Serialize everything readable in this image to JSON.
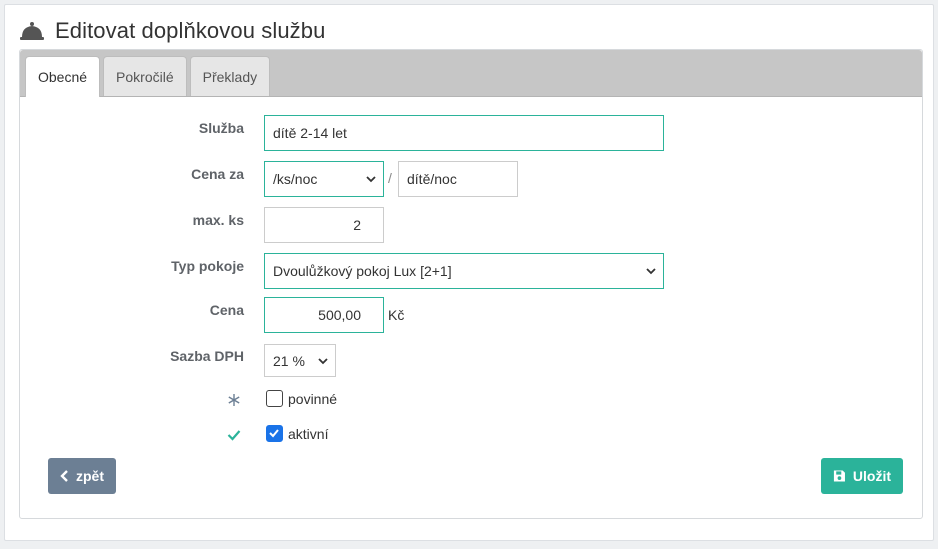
{
  "header": {
    "title": "Editovat doplňkovou službu",
    "icon": "bell-icon"
  },
  "tabs": [
    {
      "label": "Obecné",
      "active": true
    },
    {
      "label": "Pokročilé",
      "active": false
    },
    {
      "label": "Překlady",
      "active": false
    }
  ],
  "form": {
    "sluzba": {
      "label": "Služba",
      "value": "dítě 2-14 let"
    },
    "cena_za": {
      "label": "Cena za",
      "unit_value": "/ks/noc",
      "separator": "/",
      "unit2_value": "dítě/noc"
    },
    "max_ks": {
      "label": "max. ks",
      "value": "2"
    },
    "typ_pokoje": {
      "label": "Typ pokoje",
      "value": "Dvoulůžkový pokoj Lux [2+1]"
    },
    "cena": {
      "label": "Cena",
      "value": "500,00",
      "currency": "Kč"
    },
    "sazba_dph": {
      "label": "Sazba DPH",
      "value": "21 %"
    },
    "povinne": {
      "label": "povinné",
      "checked": false,
      "icon": "asterisk-icon"
    },
    "aktivni": {
      "label": "aktivní",
      "checked": true,
      "icon": "check-icon"
    }
  },
  "buttons": {
    "back": "zpět",
    "save": "Uložit"
  },
  "colors": {
    "accent": "#2bb39a",
    "back_button": "#6c7f94",
    "checkbox_checked": "#1a73e8"
  }
}
